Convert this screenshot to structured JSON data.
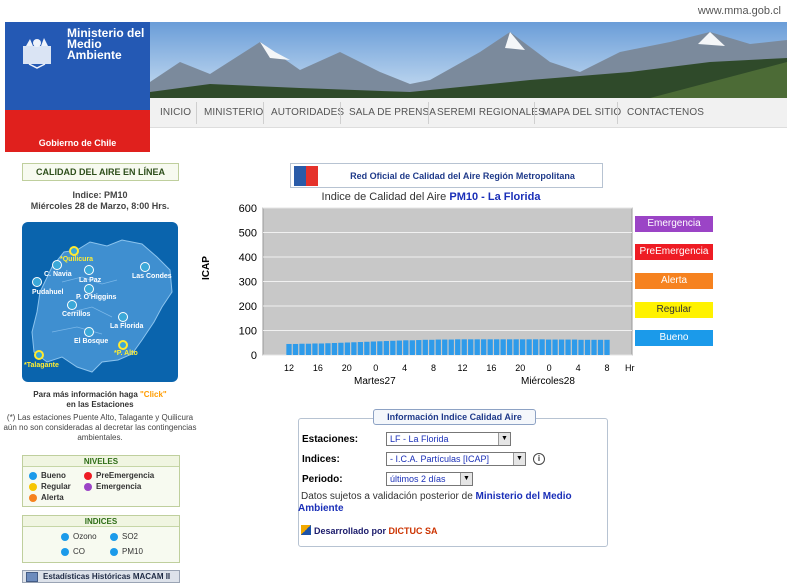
{
  "header": {
    "site_url": "www.mma.gob.cl",
    "ministry_name": "Ministerio del Medio Ambiente",
    "government": "Gobierno de Chile",
    "nav": [
      "INICIO",
      "MINISTERIO",
      "AUTORIDADES",
      "SALA DE PRENSA",
      "SEREMI REGIONALES",
      "MAPA DEL SITIO",
      "CONTACTENOS"
    ]
  },
  "sidebar": {
    "title": "CALIDAD DEL AIRE EN LÍNEA",
    "index_label": "Indice: PM10",
    "date_label": "Miércoles 28 de Marzo, 8:00 Hrs.",
    "stations": [
      "*Quilicura",
      "C. Navia",
      "Las Condes",
      "La Paz",
      "Pudahuel",
      "P. O'Higgins",
      "Cerrillos",
      "La Florida",
      "El Bosque",
      "*P. Alto",
      "*Talagante"
    ],
    "info_click_prefix": "Para más información haga",
    "info_click_link": "\"Click\"",
    "info_click_suffix": "en las Estaciones",
    "note": "(*) Las estaciones Puente Alto, Talagante y Quilicura aún no son consideradas al decretar las contingencias ambientales.",
    "levels_title": "NIVELES",
    "levels": [
      "Bueno",
      "PreEmergencia",
      "Regular",
      "Emergencia",
      "Alerta"
    ],
    "indices_title": "INDICES",
    "indices": [
      "Ozono",
      "SO2",
      "CO",
      "PM10"
    ],
    "historic_button": "Estadísticas Históricas MACAM II"
  },
  "chart_header": "Red Oficial de Calidad del Aire Región Metropolitana",
  "chart_title_prefix": "Indice de Calidad del Aire",
  "chart_title_highlight": "PM10 - La Florida",
  "chart_data": {
    "type": "bar",
    "ylabel": "ICAP",
    "ylim": [
      0,
      600
    ],
    "yticks": [
      0,
      100,
      200,
      300,
      400,
      500,
      600
    ],
    "xtick_labels": [
      "12",
      "16",
      "20",
      "0",
      "4",
      "8",
      "12",
      "16",
      "20",
      "0",
      "4",
      "8"
    ],
    "x_unit": "Hr",
    "day_labels": [
      "Martes27",
      "Miércoles28"
    ],
    "values": [
      45,
      45,
      46,
      46,
      47,
      47,
      48,
      49,
      50,
      51,
      52,
      53,
      54,
      55,
      56,
      57,
      58,
      59,
      60,
      60,
      61,
      62,
      62,
      63,
      63,
      63,
      64,
      64,
      64,
      64,
      64,
      64,
      64,
      64,
      64,
      64,
      64,
      64,
      64,
      64,
      63,
      63,
      63,
      63,
      63,
      62,
      62,
      62,
      62,
      62
    ],
    "bar_color": "#2e9bea",
    "legend": [
      {
        "label": "Emergencia",
        "color": "#9b44c6"
      },
      {
        "label": "PreEmergencia",
        "color": "#ee1c24"
      },
      {
        "label": "Alerta",
        "color": "#f6821f"
      },
      {
        "label": "Regular",
        "color": "#fff200"
      },
      {
        "label": "Bueno",
        "color": "#1b9aea"
      }
    ]
  },
  "info_panel": {
    "tab": "Información Indice Calidad Aire",
    "estaciones_label": "Estaciones:",
    "estaciones_value": "LF - La Florida",
    "indices_label": "Indices:",
    "indices_value": "- I.C.A. Partículas [ICAP]",
    "periodo_label": "Periodo:",
    "periodo_value": "últimos 2 días",
    "disclaimer_prefix": "Datos sujetos a validación posterior de",
    "disclaimer_link": "Ministerio del Medio Ambiente",
    "developed_by": "Desarrollado por",
    "developer": "DICTUC SA"
  }
}
